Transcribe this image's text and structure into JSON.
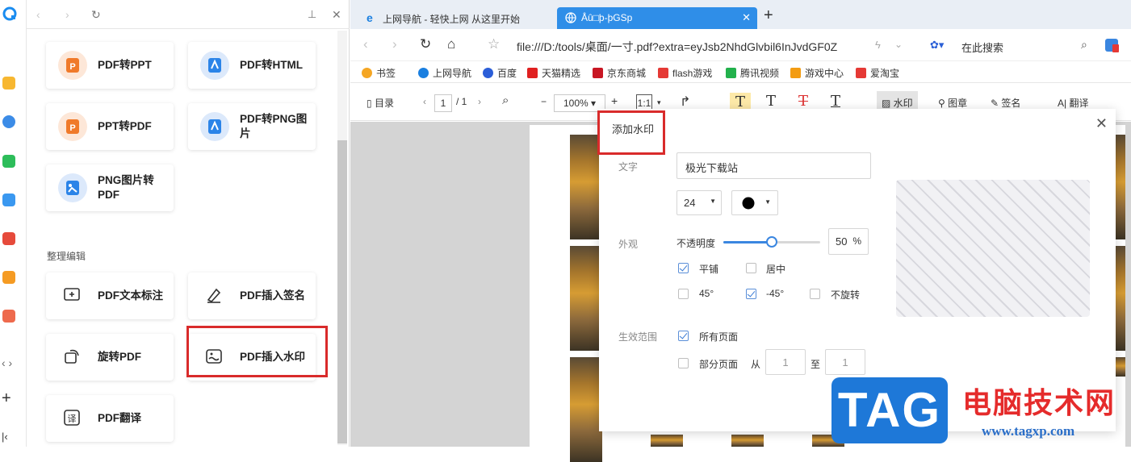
{
  "tools_panel": {
    "top_cards": [
      {
        "label": "PDF转PPT",
        "icon": "pdf-to-ppt-icon",
        "color": "orange"
      },
      {
        "label": "PDF转HTML",
        "icon": "pdf-to-html-icon",
        "color": "blue"
      },
      {
        "label": "PPT转PDF",
        "icon": "ppt-to-pdf-icon",
        "color": "orange"
      },
      {
        "label": "PDF转PNG图片",
        "icon": "pdf-to-png-icon",
        "color": "blue"
      },
      {
        "label": "PNG图片转PDF",
        "icon": "png-to-pdf-icon",
        "color": "blue"
      }
    ],
    "section_title": "整理编辑",
    "edit_cards": [
      {
        "label": "PDF文本标注",
        "icon": "text-annotate-icon"
      },
      {
        "label": "PDF插入签名",
        "icon": "signature-icon"
      },
      {
        "label": "旋转PDF",
        "icon": "rotate-icon"
      },
      {
        "label": "PDF插入水印",
        "icon": "watermark-icon"
      },
      {
        "label": "PDF翻译",
        "icon": "translate-icon"
      }
    ]
  },
  "browser": {
    "tabs": [
      {
        "title": "上网导航 - 轻快上网 从这里开始",
        "active": false
      },
      {
        "title": "Åû□þ-þGSp",
        "active": true
      }
    ],
    "url": "file:///D:/tools/桌面/一寸.pdf?extra=eyJsb2NhdGlvbil6InJvdGF0Z",
    "search_placeholder": "在此搜索",
    "bookmarks": [
      "书签",
      "上网导航",
      "百度",
      "天猫精选",
      "京东商城",
      "flash游戏",
      "腾讯视频",
      "游戏中心",
      "爱淘宝"
    ]
  },
  "pdf_toolbar": {
    "outline": "目录",
    "page_current": "1",
    "page_total": "/ 1",
    "zoom": "100%",
    "fit": "1:1",
    "watermark": "水印",
    "stamp": "图章",
    "sign": "签名",
    "translate": "翻译"
  },
  "dialog": {
    "title": "添加水印",
    "text_label": "文字",
    "text_value": "极光下载站",
    "font_size": "24",
    "color": "#000000",
    "appearance_label": "外观",
    "opacity_label": "不透明度",
    "opacity_value": "50",
    "opacity_unit": "%",
    "opacity_fraction": 0.5,
    "tile_label": "平铺",
    "tile_checked": true,
    "center_label": "居中",
    "center_checked": false,
    "rot45_label": "45°",
    "rot45_checked": false,
    "rotm45_label": "-45°",
    "rotm45_checked": true,
    "norotate_label": "不旋转",
    "norotate_checked": false,
    "scope_label": "生效范围",
    "all_pages_label": "所有页面",
    "all_pages_checked": true,
    "some_pages_label": "部分页面",
    "some_pages_checked": false,
    "from_label": "从",
    "from_value": "1",
    "to_label": "至",
    "to_value": "1"
  },
  "watermark_logo": {
    "tag": "TAG",
    "cn": "电脑技术网",
    "url": "www.tagxp.com"
  }
}
